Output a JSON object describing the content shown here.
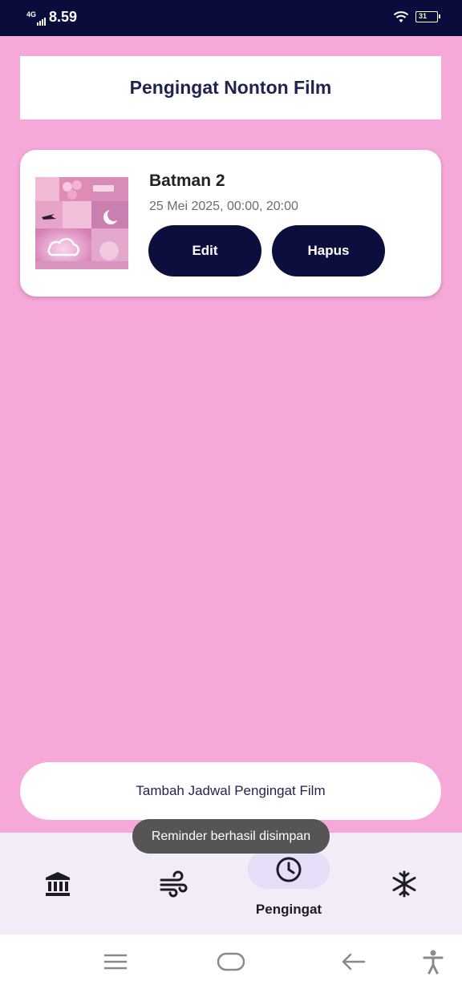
{
  "status_bar": {
    "network": "4G",
    "time": "8.59",
    "battery": "31"
  },
  "header": {
    "title": "Pengingat Nonton Film"
  },
  "reminders": [
    {
      "title": "Batman 2",
      "schedule": "25 Mei 2025, 00:00, 20:00",
      "edit_label": "Edit",
      "delete_label": "Hapus"
    }
  ],
  "add_button": {
    "label": "Tambah Jadwal Pengingat Film"
  },
  "toast": {
    "message": "Reminder berhasil disimpan"
  },
  "bottom_nav": {
    "items": [
      {
        "icon": "bank-icon",
        "label": ""
      },
      {
        "icon": "wind-icon",
        "label": ""
      },
      {
        "icon": "clock-icon",
        "label": "Pengingat",
        "active": true
      },
      {
        "icon": "snowflake-icon",
        "label": ""
      }
    ]
  },
  "system_nav": [
    "menu-icon",
    "home-icon",
    "back-icon",
    "accessibility-icon"
  ],
  "colors": {
    "background": "#f6a8d9",
    "primary_dark": "#0c0e3e",
    "status_bar": "#0a0d3b",
    "nav_background": "#f2ecf6",
    "nav_active_pill": "#e6def8",
    "toast": "#555556"
  }
}
